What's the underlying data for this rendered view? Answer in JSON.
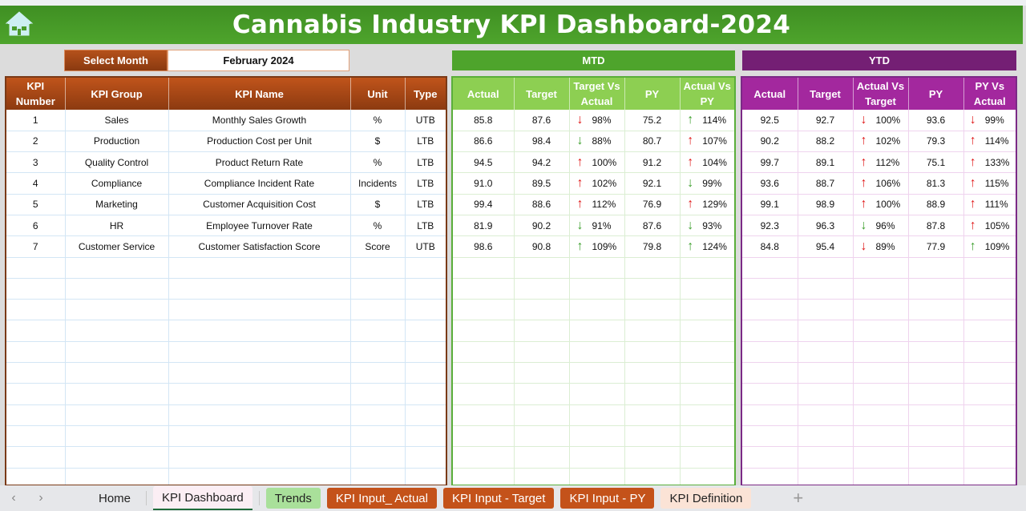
{
  "header": {
    "title": "Cannabis Industry KPI Dashboard-2024",
    "home_icon": "home-icon"
  },
  "month_selector": {
    "label": "Select Month",
    "value": "February 2024"
  },
  "sections": {
    "mtd": "MTD",
    "ytd": "YTD"
  },
  "kpi_columns": [
    "KPI Number",
    "KPI Group",
    "KPI Name",
    "Unit",
    "Type"
  ],
  "mtd_columns": [
    "Actual",
    "Target",
    "Target Vs Actual",
    "PY",
    "Actual Vs PY"
  ],
  "ytd_columns": [
    "Actual",
    "Target",
    "Actual Vs Target",
    "PY",
    "PY Vs Actual"
  ],
  "colors": {
    "banner": "#4ea42c",
    "kpi_header": "#b5511b",
    "mtd_header": "#8dcf52",
    "ytd_header": "#a3289e",
    "arrow_red": "#e01b1b",
    "arrow_green": "#3ea02e"
  },
  "rows": [
    {
      "num": "1",
      "group": "Sales",
      "name": "Monthly Sales Growth",
      "unit": "%",
      "type": "UTB",
      "mtd": {
        "actual": "85.8",
        "target": "87.6",
        "tva": {
          "dir": "down",
          "color": "red",
          "pct": "98%"
        },
        "py": "75.2",
        "avp": {
          "dir": "up",
          "color": "green",
          "pct": "114%"
        }
      },
      "ytd": {
        "actual": "92.5",
        "target": "92.7",
        "avt": {
          "dir": "down",
          "color": "red",
          "pct": "100%"
        },
        "py": "93.6",
        "pva": {
          "dir": "down",
          "color": "red",
          "pct": "99%"
        }
      }
    },
    {
      "num": "2",
      "group": "Production",
      "name": "Production Cost per Unit",
      "unit": "$",
      "type": "LTB",
      "mtd": {
        "actual": "86.6",
        "target": "98.4",
        "tva": {
          "dir": "down",
          "color": "green",
          "pct": "88%"
        },
        "py": "80.7",
        "avp": {
          "dir": "up",
          "color": "red",
          "pct": "107%"
        }
      },
      "ytd": {
        "actual": "90.2",
        "target": "88.2",
        "avt": {
          "dir": "up",
          "color": "red",
          "pct": "102%"
        },
        "py": "79.3",
        "pva": {
          "dir": "up",
          "color": "red",
          "pct": "114%"
        }
      }
    },
    {
      "num": "3",
      "group": "Quality Control",
      "name": "Product Return Rate",
      "unit": "%",
      "type": "LTB",
      "mtd": {
        "actual": "94.5",
        "target": "94.2",
        "tva": {
          "dir": "up",
          "color": "red",
          "pct": "100%"
        },
        "py": "91.2",
        "avp": {
          "dir": "up",
          "color": "red",
          "pct": "104%"
        }
      },
      "ytd": {
        "actual": "99.7",
        "target": "89.1",
        "avt": {
          "dir": "up",
          "color": "red",
          "pct": "112%"
        },
        "py": "75.1",
        "pva": {
          "dir": "up",
          "color": "red",
          "pct": "133%"
        }
      }
    },
    {
      "num": "4",
      "group": "Compliance",
      "name": "Compliance Incident Rate",
      "unit": "Incidents",
      "type": "LTB",
      "mtd": {
        "actual": "91.0",
        "target": "89.5",
        "tva": {
          "dir": "up",
          "color": "red",
          "pct": "102%"
        },
        "py": "92.1",
        "avp": {
          "dir": "down",
          "color": "green",
          "pct": "99%"
        }
      },
      "ytd": {
        "actual": "93.6",
        "target": "88.7",
        "avt": {
          "dir": "up",
          "color": "red",
          "pct": "106%"
        },
        "py": "81.3",
        "pva": {
          "dir": "up",
          "color": "red",
          "pct": "115%"
        }
      }
    },
    {
      "num": "5",
      "group": "Marketing",
      "name": "Customer Acquisition Cost",
      "unit": "$",
      "type": "LTB",
      "mtd": {
        "actual": "99.4",
        "target": "88.6",
        "tva": {
          "dir": "up",
          "color": "red",
          "pct": "112%"
        },
        "py": "76.9",
        "avp": {
          "dir": "up",
          "color": "red",
          "pct": "129%"
        }
      },
      "ytd": {
        "actual": "99.1",
        "target": "98.9",
        "avt": {
          "dir": "up",
          "color": "red",
          "pct": "100%"
        },
        "py": "88.9",
        "pva": {
          "dir": "up",
          "color": "red",
          "pct": "111%"
        }
      }
    },
    {
      "num": "6",
      "group": "HR",
      "name": "Employee Turnover Rate",
      "unit": "%",
      "type": "LTB",
      "mtd": {
        "actual": "81.9",
        "target": "90.2",
        "tva": {
          "dir": "down",
          "color": "green",
          "pct": "91%"
        },
        "py": "87.6",
        "avp": {
          "dir": "down",
          "color": "green",
          "pct": "93%"
        }
      },
      "ytd": {
        "actual": "92.3",
        "target": "96.3",
        "avt": {
          "dir": "down",
          "color": "green",
          "pct": "96%"
        },
        "py": "87.8",
        "pva": {
          "dir": "up",
          "color": "red",
          "pct": "105%"
        }
      }
    },
    {
      "num": "7",
      "group": "Customer Service",
      "name": "Customer Satisfaction Score",
      "unit": "Score",
      "type": "UTB",
      "mtd": {
        "actual": "98.6",
        "target": "90.8",
        "tva": {
          "dir": "up",
          "color": "green",
          "pct": "109%"
        },
        "py": "79.8",
        "avp": {
          "dir": "up",
          "color": "green",
          "pct": "124%"
        }
      },
      "ytd": {
        "actual": "84.8",
        "target": "95.4",
        "avt": {
          "dir": "down",
          "color": "red",
          "pct": "89%"
        },
        "py": "77.9",
        "pva": {
          "dir": "up",
          "color": "green",
          "pct": "109%"
        }
      }
    }
  ],
  "empty_rows": 11,
  "sheet_tabs": [
    {
      "label": "Home",
      "style": "plain"
    },
    {
      "label": "KPI Dashboard",
      "style": "active"
    },
    {
      "label": "Trends",
      "style": "green"
    },
    {
      "label": "KPI Input_ Actual",
      "style": "orange"
    },
    {
      "label": "KPI Input - Target",
      "style": "orange"
    },
    {
      "label": "KPI Input - PY",
      "style": "orange"
    },
    {
      "label": "KPI Definition",
      "style": "peach"
    }
  ],
  "tab_nav": {
    "prev": "‹",
    "next": "›",
    "add": "+"
  }
}
